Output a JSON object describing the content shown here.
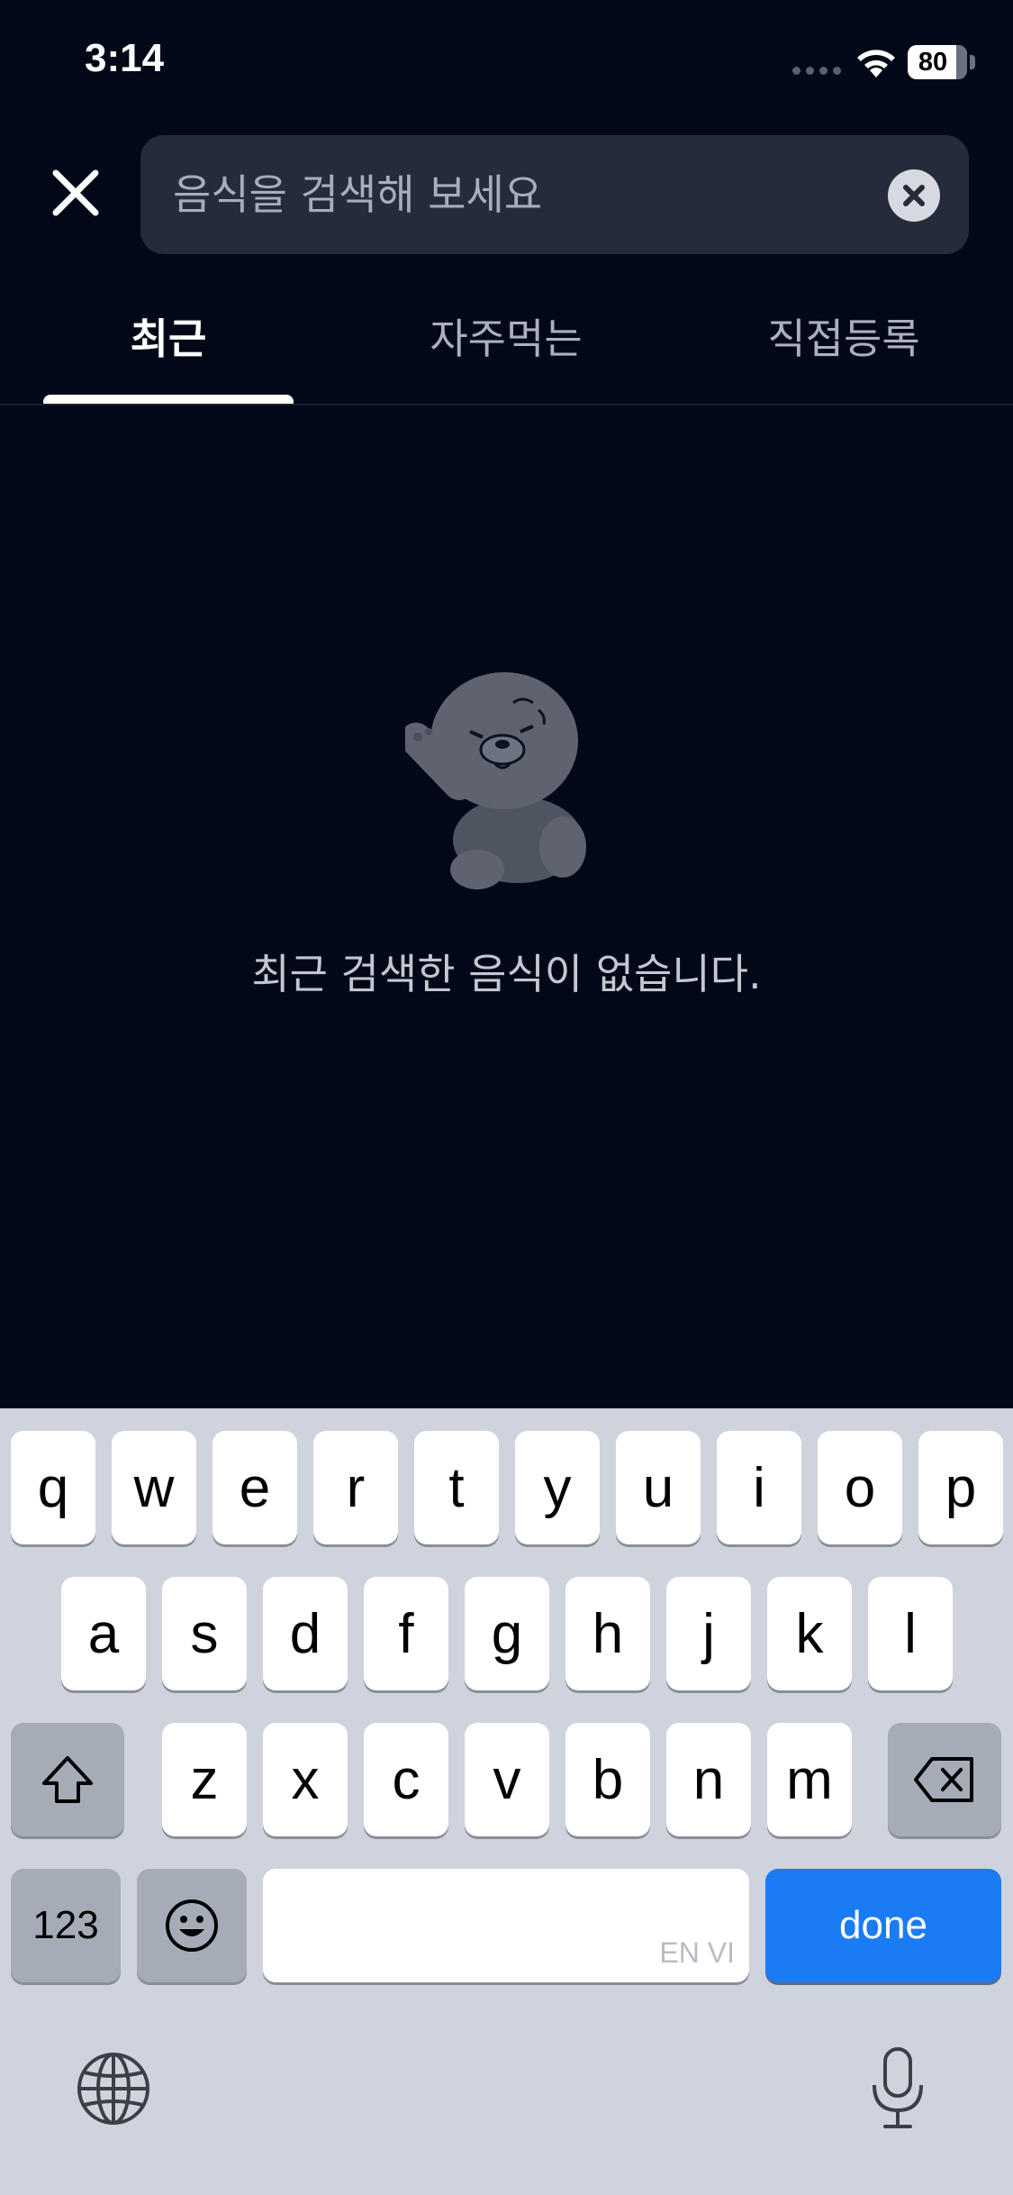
{
  "status_bar": {
    "time": "3:14",
    "battery": "80"
  },
  "search": {
    "placeholder": "음식을 검색해 보세요",
    "value": ""
  },
  "tabs": [
    {
      "label": "최근",
      "active": true
    },
    {
      "label": "자주먹는",
      "active": false
    },
    {
      "label": "직접등록",
      "active": false
    }
  ],
  "empty_state": {
    "message": "최근 검색한 음식이 없습니다."
  },
  "keyboard": {
    "row1": [
      "q",
      "w",
      "e",
      "r",
      "t",
      "y",
      "u",
      "i",
      "o",
      "p"
    ],
    "row2": [
      "a",
      "s",
      "d",
      "f",
      "g",
      "h",
      "j",
      "k",
      "l"
    ],
    "row3": [
      "z",
      "x",
      "c",
      "v",
      "b",
      "n",
      "m"
    ],
    "numbers_label": "123",
    "space_languages": "EN VI",
    "done_label": "done"
  },
  "colors": {
    "background": "#020818",
    "accent": "#1a7cf5",
    "search_box": "#242c3c"
  }
}
